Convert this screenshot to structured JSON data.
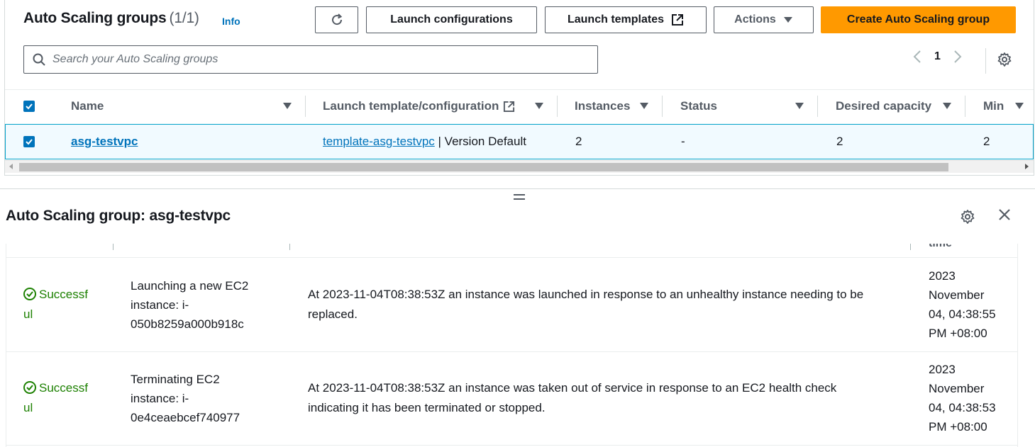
{
  "header": {
    "title": "Auto Scaling groups",
    "count": "(1/1)",
    "info_label": "Info"
  },
  "toolbar": {
    "refresh_icon": "refresh-icon",
    "launch_configurations_label": "Launch configurations",
    "launch_templates_label": "Launch templates",
    "actions_label": "Actions",
    "create_label": "Create Auto Scaling group"
  },
  "search": {
    "placeholder": "Search your Auto Scaling groups",
    "value": ""
  },
  "pagination": {
    "current_page": "1"
  },
  "table": {
    "columns": {
      "name": "Name",
      "launch_template": "Launch template/configuration",
      "instances": "Instances",
      "status": "Status",
      "desired_capacity": "Desired capacity",
      "min": "Min"
    },
    "rows": [
      {
        "selected": true,
        "name": "asg-testvpc",
        "template_link": "template-asg-testvpc",
        "template_version": "| Version Default",
        "instances": "2",
        "status": "-",
        "desired_capacity": "2",
        "min": "2"
      }
    ]
  },
  "split_panel": {
    "title": "Auto Scaling group: asg-testvpc",
    "header_cut_text": "time",
    "activities": [
      {
        "status_line1": "Successf",
        "status_line2": "ul",
        "description_line1": "Launching a new EC2",
        "description_line2": "instance: i-",
        "description_line3": "050b8259a000b918c",
        "cause_line1": "At 2023-11-04T08:38:53Z an instance was launched in response to an unhealthy instance needing to be",
        "cause_line2": "replaced.",
        "time_line1": "2023",
        "time_line2": "November",
        "time_line3": "04, 04:38:55",
        "time_line4": "PM +08:00"
      },
      {
        "status_line1": "Successf",
        "status_line2": "ul",
        "description_line1": "Terminating EC2",
        "description_line2": "instance: i-",
        "description_line3": "0e4ceaebcef740977",
        "cause_line1": "At 2023-11-04T08:38:53Z an instance was taken out of service in response to an EC2 health check",
        "cause_line2": "indicating it has been terminated or stopped.",
        "time_line1": "2023",
        "time_line2": "November",
        "time_line3": "04, 04:38:53",
        "time_line4": "PM +08:00"
      }
    ]
  },
  "colors": {
    "primary_button": "#ff9900",
    "link": "#0073bb",
    "success": "#1d8102",
    "selected_row_bg": "#f1faff"
  }
}
